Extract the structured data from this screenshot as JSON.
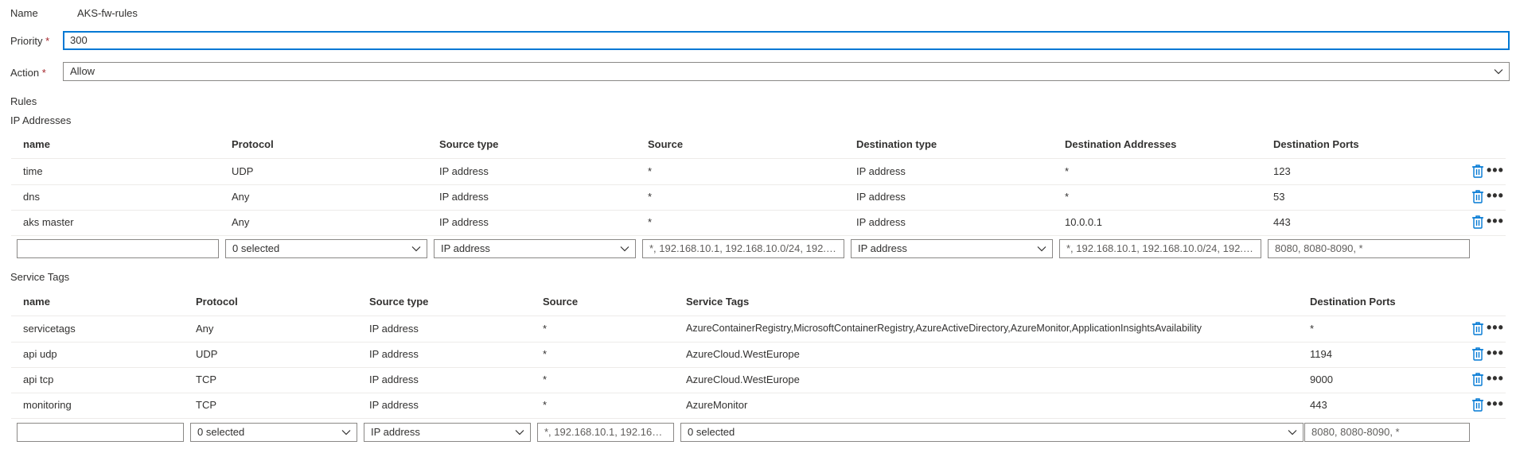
{
  "form": {
    "name_label": "Name",
    "name_value": "AKS-fw-rules",
    "priority_label": "Priority",
    "priority_value": "300",
    "action_label": "Action",
    "action_value": "Allow",
    "required_mark": "*"
  },
  "rules_label": "Rules",
  "ip_addresses": {
    "title": "IP Addresses",
    "columns": [
      "name",
      "Protocol",
      "Source type",
      "Source",
      "Destination type",
      "Destination Addresses",
      "Destination Ports"
    ],
    "rows": [
      [
        "time",
        "UDP",
        "IP address",
        "*",
        "IP address",
        "*",
        "123"
      ],
      [
        "dns",
        "Any",
        "IP address",
        "*",
        "IP address",
        "*",
        "53"
      ],
      [
        "aks master",
        "Any",
        "IP address",
        "*",
        "IP address",
        "10.0.0.1",
        "443"
      ]
    ],
    "new_row": {
      "name": "",
      "protocol": "0 selected",
      "source_type": "IP address",
      "source_placeholder": "*, 192.168.10.1, 192.168.10.0/24, 192.16...",
      "destination_type": "IP address",
      "destination_addresses_placeholder": "*, 192.168.10.1, 192.168.10.0/24, 192.16...",
      "destination_ports_placeholder": "8080, 8080-8090, *"
    }
  },
  "service_tags": {
    "title": "Service Tags",
    "columns": [
      "name",
      "Protocol",
      "Source type",
      "Source",
      "Service Tags",
      "Destination Ports"
    ],
    "rows": [
      [
        "servicetags",
        "Any",
        "IP address",
        "*",
        "AzureContainerRegistry,MicrosoftContainerRegistry,AzureActiveDirectory,AzureMonitor,ApplicationInsightsAvailability",
        "*"
      ],
      [
        "api udp",
        "UDP",
        "IP address",
        "*",
        "AzureCloud.WestEurope",
        "1194"
      ],
      [
        "api tcp",
        "TCP",
        "IP address",
        "*",
        "AzureCloud.WestEurope",
        "9000"
      ],
      [
        "monitoring",
        "TCP",
        "IP address",
        "*",
        "AzureMonitor",
        "443"
      ]
    ],
    "new_row": {
      "name": "",
      "protocol": "0 selected",
      "source_type": "IP address",
      "source_placeholder": "*, 192.168.10.1, 192.168.1...",
      "service_tags": "0 selected",
      "destination_ports_placeholder": "8080, 8080-8090, *"
    }
  },
  "row_actions": {
    "delete_icon": "trash-icon",
    "more_icon": "more-icon",
    "more_glyph": "•••"
  },
  "colors": {
    "accent": "#0078d4",
    "required": "#a4262c",
    "border": "#8a8886"
  }
}
